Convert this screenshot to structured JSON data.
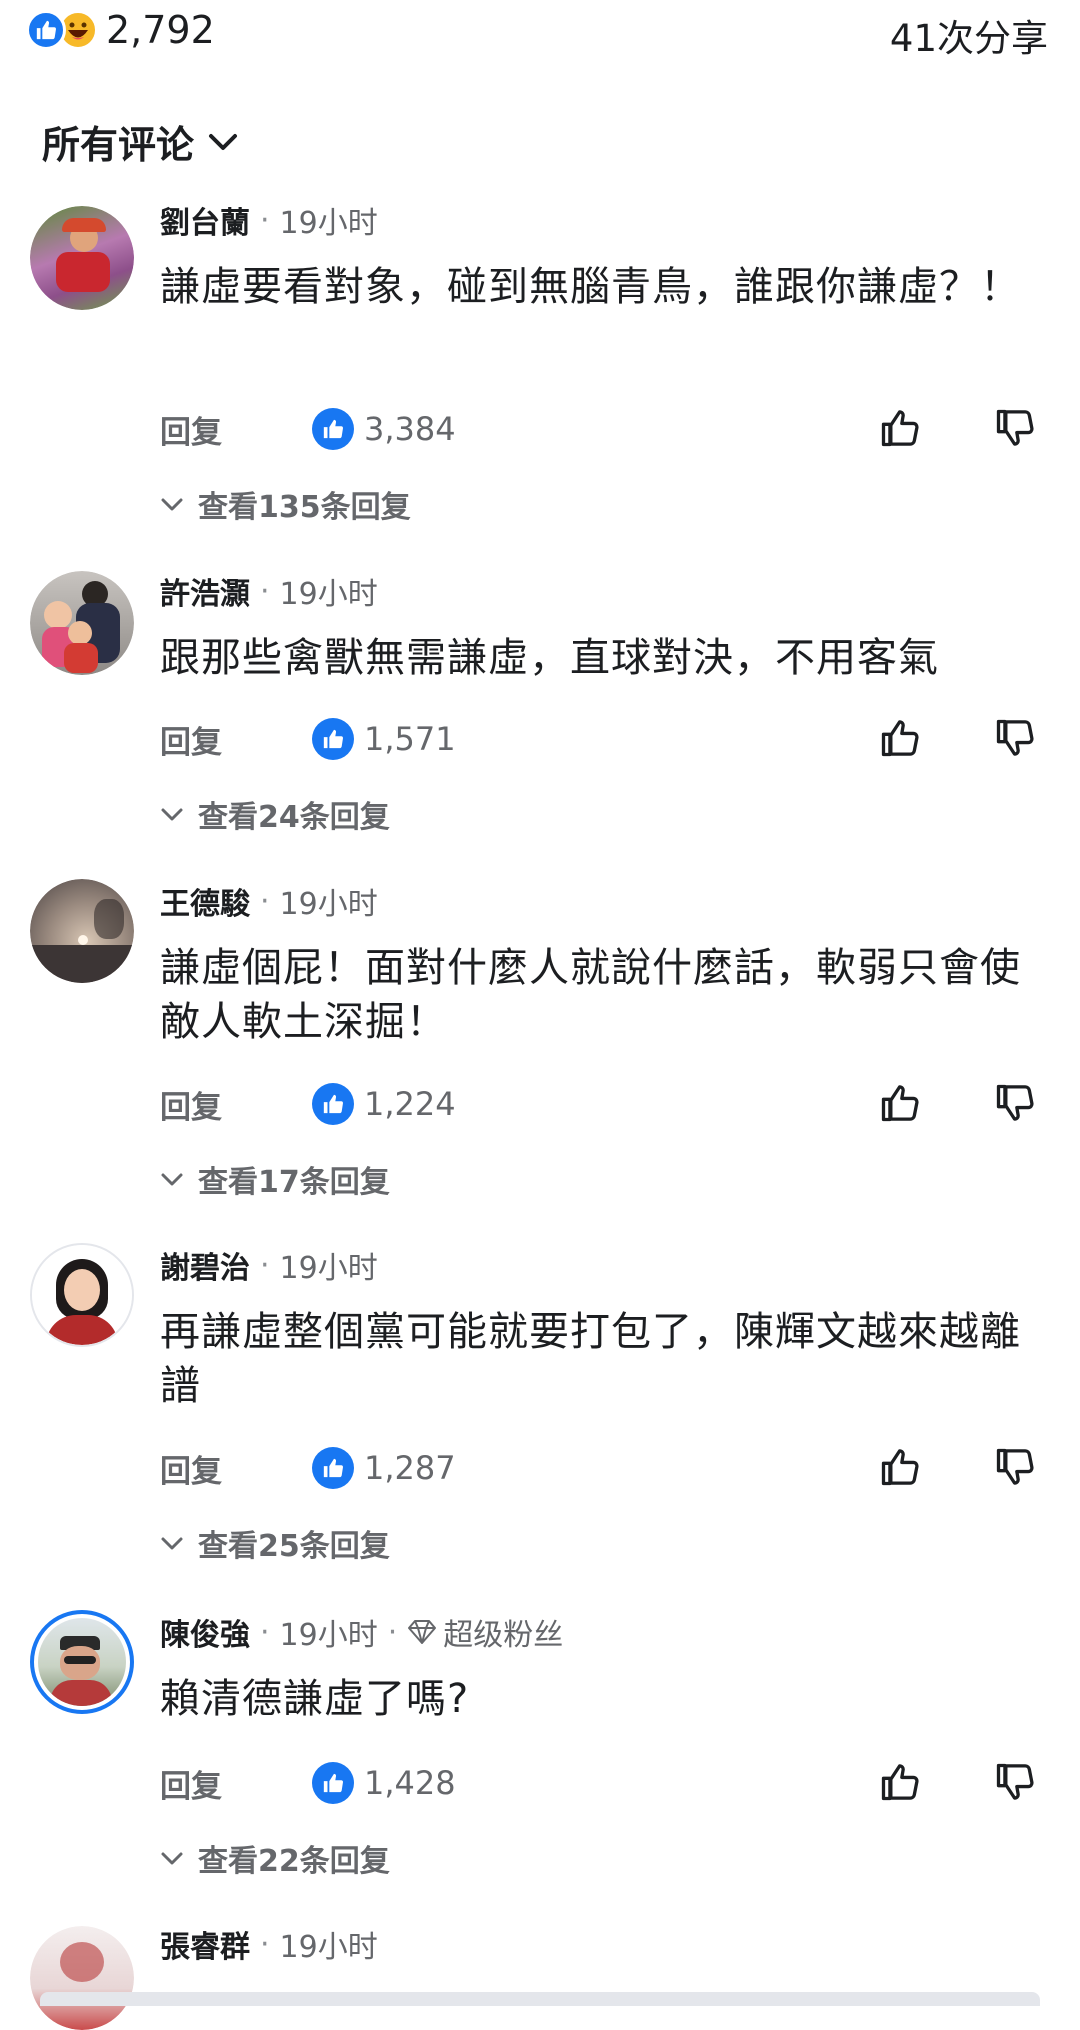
{
  "header": {
    "reaction_count": "2,792",
    "shares": "41次分享"
  },
  "sort_label": "所有评论",
  "comments": [
    {
      "name": "劉台蘭",
      "time": "19小时",
      "text": "謙虛要看對象，碰到無腦青鳥，誰跟你謙虛？！",
      "reply": "回复",
      "likes": "3,384",
      "view_replies": "查看135条回复"
    },
    {
      "name": "許浩灝",
      "time": "19小时",
      "text": "跟那些禽獸無需謙虛，直球對決，不用客氣",
      "reply": "回复",
      "likes": "1,571",
      "view_replies": "查看24条回复"
    },
    {
      "name": "王德駿",
      "time": "19小时",
      "text": "謙虛個屁！面對什麼人就說什麼話，軟弱只會使敵人軟土深掘！",
      "reply": "回复",
      "likes": "1,224",
      "view_replies": "查看17条回复"
    },
    {
      "name": "謝碧治",
      "time": "19小时",
      "text": "再謙虛整個黨可能就要打包了，陳輝文越來越離譜",
      "reply": "回复",
      "likes": "1,287",
      "view_replies": "查看25条回复"
    },
    {
      "name": "陳俊強",
      "time": "19小时",
      "badge": "超级粉丝",
      "text": "賴清德謙虛了嗎?",
      "reply": "回复",
      "likes": "1,428",
      "view_replies": "查看22条回复"
    },
    {
      "name": "張睿群",
      "time": "19小时"
    }
  ],
  "colors": {
    "accent": "#1877f2",
    "secondary_text": "#65676b",
    "haha": "#f7b928"
  },
  "icons": [
    "like-reaction-icon",
    "haha-reaction-icon",
    "chevron-down-icon",
    "thumbs-up-icon",
    "thumbs-down-icon",
    "diamond-icon"
  ]
}
